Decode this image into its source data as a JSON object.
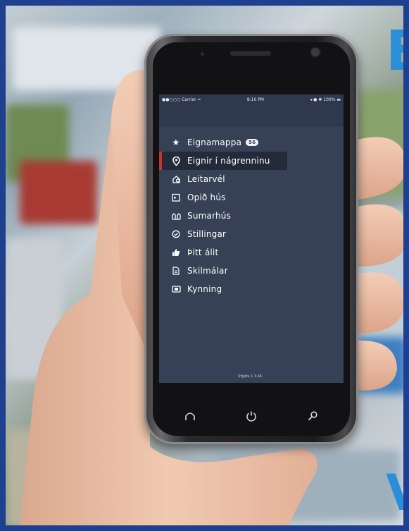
{
  "background": {
    "letters": [
      {
        "text": "E",
        "id": "top"
      },
      {
        "text": "V",
        "id": "bottom"
      }
    ],
    "accent": "#2a8fd6",
    "frame_color": "#1f3f8f"
  },
  "status_bar": {
    "carrier": "●●○○○ Carrier ≈",
    "time": "8:10 PM",
    "battery": "◂ ● ✱ 100% ▬"
  },
  "menu": {
    "items": [
      {
        "label": "Eignamappa",
        "icon": "star-icon",
        "badge": "56",
        "active": false
      },
      {
        "label": "Eignir í nágrenninu",
        "icon": "location-pin-icon",
        "active": true
      },
      {
        "label": "Leitarvél",
        "icon": "search-engine-icon",
        "active": false
      },
      {
        "label": "Opið hús",
        "icon": "calendar-icon",
        "active": false
      },
      {
        "label": "Sumarhús",
        "icon": "cabin-icon",
        "active": false
      },
      {
        "label": "Stillingar",
        "icon": "settings-icon",
        "active": false
      },
      {
        "label": "Þitt álit",
        "icon": "thumbs-up-icon",
        "active": false
      },
      {
        "label": "Skilmálar",
        "icon": "document-icon",
        "active": false
      },
      {
        "label": "Kynning",
        "icon": "presentation-icon",
        "active": false
      }
    ],
    "active_color": "#c9342c",
    "bg_color": "#364156"
  },
  "version": "Útgáfa 1.3.46",
  "nav_buttons": [
    {
      "name": "home-icon"
    },
    {
      "name": "power-icon"
    },
    {
      "name": "search-icon"
    }
  ]
}
